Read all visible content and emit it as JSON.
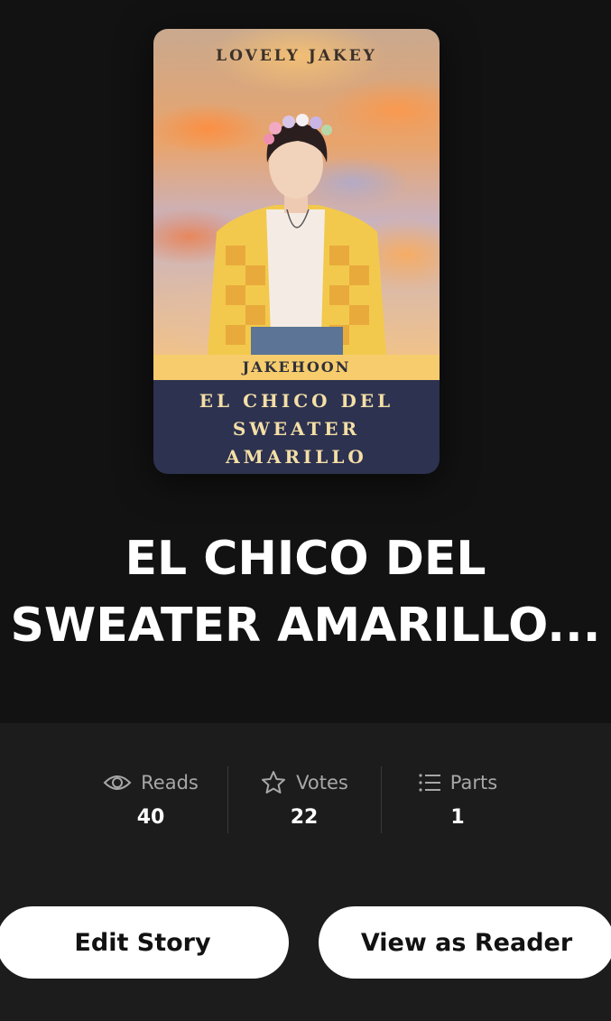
{
  "cover": {
    "author": "LOVELY JAKEY",
    "band": "JAKEHOON",
    "title_lines": [
      "EL CHICO DEL",
      "SWEATER",
      "AMARILLO"
    ]
  },
  "story": {
    "title_line1": "EL CHICO DEL",
    "title_line2": "SWEATER AMARILLO..."
  },
  "stats": {
    "reads": {
      "label": "Reads",
      "value": "40",
      "icon": "eye-icon"
    },
    "votes": {
      "label": "Votes",
      "value": "22",
      "icon": "star-icon"
    },
    "parts": {
      "label": "Parts",
      "value": "1",
      "icon": "list-icon"
    }
  },
  "actions": {
    "edit": "Edit Story",
    "view": "View as Reader"
  },
  "colors": {
    "background": "#121212",
    "panel": "#1c1c1c",
    "button": "#ffffff",
    "cover_band": "#f6cc6c",
    "cover_bottom": "#2d3250"
  }
}
